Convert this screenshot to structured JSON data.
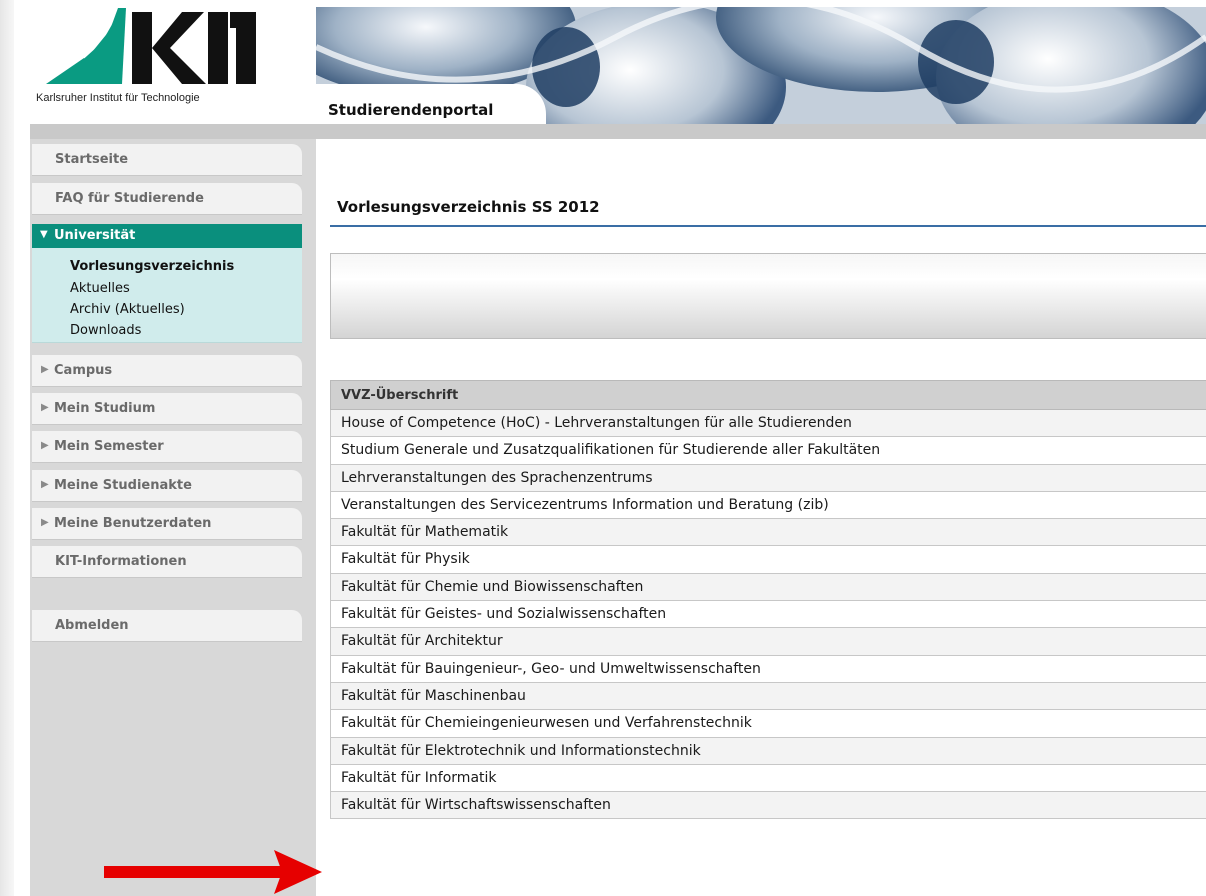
{
  "header": {
    "logo_text": "KIT",
    "logo_subtitle": "Karlsruher Institut für Technologie",
    "portal_title": "Studierendenportal"
  },
  "sidebar": {
    "items": [
      {
        "label": "Startseite"
      },
      {
        "label": "FAQ für Studierende"
      }
    ],
    "active_section": {
      "label": "Universität",
      "subitems": [
        {
          "label": "Vorlesungsverzeichnis",
          "active": true
        },
        {
          "label": "Aktuelles"
        },
        {
          "label": "Archiv (Aktuelles)"
        },
        {
          "label": "Downloads"
        }
      ]
    },
    "collapsed_sections": [
      {
        "label": "Campus"
      },
      {
        "label": "Mein Studium"
      },
      {
        "label": "Mein Semester"
      },
      {
        "label": "Meine Studienakte"
      },
      {
        "label": "Meine Benutzerdaten"
      }
    ],
    "kit_info": "KIT-Informationen",
    "logout": "Abmelden"
  },
  "content": {
    "title": "Vorlesungsverzeichnis SS 2012",
    "table": {
      "header": "VVZ-Überschrift",
      "rows": [
        "House of Competence (HoC) - Lehrveranstaltungen für alle Studierenden",
        "Studium Generale und Zusatzqualifikationen für Studierende aller Fakultäten",
        "Lehrveranstaltungen des Sprachenzentrums",
        "Veranstaltungen des Servicezentrums Information und Beratung (zib)",
        "Fakultät für Mathematik",
        "Fakultät für Physik",
        "Fakultät für Chemie und Biowissenschaften",
        "Fakultät für Geistes- und Sozialwissenschaften",
        "Fakultät für Architektur",
        "Fakultät für Bauingenieur-, Geo- und Umweltwissenschaften",
        "Fakultät für Maschinenbau",
        "Fakultät für Chemieingenieurwesen und Verfahrenstechnik",
        "Fakultät für Elektrotechnik und Informationstechnik",
        "Fakultät für Informatik",
        "Fakultät für Wirtschaftswissenschaften"
      ]
    }
  },
  "colors": {
    "accent_green": "#0a8f7d",
    "submenu_bg": "#d0ecec",
    "annotation_red": "#e60000"
  }
}
